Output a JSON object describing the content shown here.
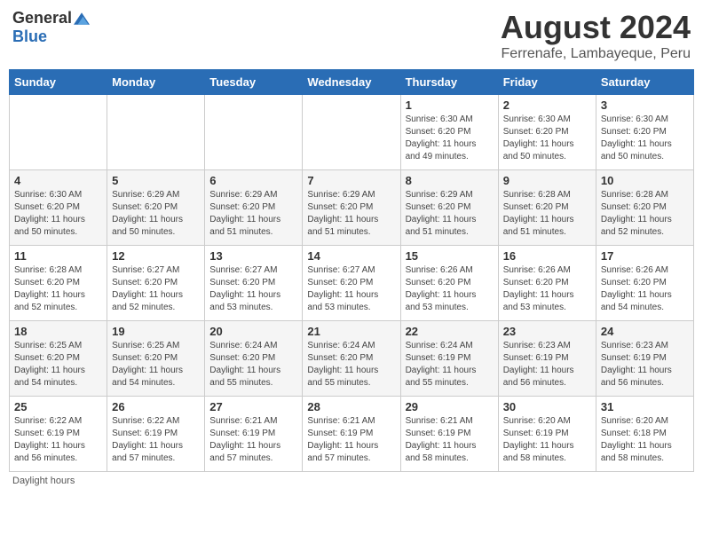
{
  "header": {
    "logo_general": "General",
    "logo_blue": "Blue",
    "month_year": "August 2024",
    "location": "Ferrenafe, Lambayeque, Peru"
  },
  "days_of_week": [
    "Sunday",
    "Monday",
    "Tuesday",
    "Wednesday",
    "Thursday",
    "Friday",
    "Saturday"
  ],
  "weeks": [
    [
      {
        "day": "",
        "info": ""
      },
      {
        "day": "",
        "info": ""
      },
      {
        "day": "",
        "info": ""
      },
      {
        "day": "",
        "info": ""
      },
      {
        "day": "1",
        "info": "Sunrise: 6:30 AM\nSunset: 6:20 PM\nDaylight: 11 hours\nand 49 minutes."
      },
      {
        "day": "2",
        "info": "Sunrise: 6:30 AM\nSunset: 6:20 PM\nDaylight: 11 hours\nand 50 minutes."
      },
      {
        "day": "3",
        "info": "Sunrise: 6:30 AM\nSunset: 6:20 PM\nDaylight: 11 hours\nand 50 minutes."
      }
    ],
    [
      {
        "day": "4",
        "info": "Sunrise: 6:30 AM\nSunset: 6:20 PM\nDaylight: 11 hours\nand 50 minutes."
      },
      {
        "day": "5",
        "info": "Sunrise: 6:29 AM\nSunset: 6:20 PM\nDaylight: 11 hours\nand 50 minutes."
      },
      {
        "day": "6",
        "info": "Sunrise: 6:29 AM\nSunset: 6:20 PM\nDaylight: 11 hours\nand 51 minutes."
      },
      {
        "day": "7",
        "info": "Sunrise: 6:29 AM\nSunset: 6:20 PM\nDaylight: 11 hours\nand 51 minutes."
      },
      {
        "day": "8",
        "info": "Sunrise: 6:29 AM\nSunset: 6:20 PM\nDaylight: 11 hours\nand 51 minutes."
      },
      {
        "day": "9",
        "info": "Sunrise: 6:28 AM\nSunset: 6:20 PM\nDaylight: 11 hours\nand 51 minutes."
      },
      {
        "day": "10",
        "info": "Sunrise: 6:28 AM\nSunset: 6:20 PM\nDaylight: 11 hours\nand 52 minutes."
      }
    ],
    [
      {
        "day": "11",
        "info": "Sunrise: 6:28 AM\nSunset: 6:20 PM\nDaylight: 11 hours\nand 52 minutes."
      },
      {
        "day": "12",
        "info": "Sunrise: 6:27 AM\nSunset: 6:20 PM\nDaylight: 11 hours\nand 52 minutes."
      },
      {
        "day": "13",
        "info": "Sunrise: 6:27 AM\nSunset: 6:20 PM\nDaylight: 11 hours\nand 53 minutes."
      },
      {
        "day": "14",
        "info": "Sunrise: 6:27 AM\nSunset: 6:20 PM\nDaylight: 11 hours\nand 53 minutes."
      },
      {
        "day": "15",
        "info": "Sunrise: 6:26 AM\nSunset: 6:20 PM\nDaylight: 11 hours\nand 53 minutes."
      },
      {
        "day": "16",
        "info": "Sunrise: 6:26 AM\nSunset: 6:20 PM\nDaylight: 11 hours\nand 53 minutes."
      },
      {
        "day": "17",
        "info": "Sunrise: 6:26 AM\nSunset: 6:20 PM\nDaylight: 11 hours\nand 54 minutes."
      }
    ],
    [
      {
        "day": "18",
        "info": "Sunrise: 6:25 AM\nSunset: 6:20 PM\nDaylight: 11 hours\nand 54 minutes."
      },
      {
        "day": "19",
        "info": "Sunrise: 6:25 AM\nSunset: 6:20 PM\nDaylight: 11 hours\nand 54 minutes."
      },
      {
        "day": "20",
        "info": "Sunrise: 6:24 AM\nSunset: 6:20 PM\nDaylight: 11 hours\nand 55 minutes."
      },
      {
        "day": "21",
        "info": "Sunrise: 6:24 AM\nSunset: 6:20 PM\nDaylight: 11 hours\nand 55 minutes."
      },
      {
        "day": "22",
        "info": "Sunrise: 6:24 AM\nSunset: 6:19 PM\nDaylight: 11 hours\nand 55 minutes."
      },
      {
        "day": "23",
        "info": "Sunrise: 6:23 AM\nSunset: 6:19 PM\nDaylight: 11 hours\nand 56 minutes."
      },
      {
        "day": "24",
        "info": "Sunrise: 6:23 AM\nSunset: 6:19 PM\nDaylight: 11 hours\nand 56 minutes."
      }
    ],
    [
      {
        "day": "25",
        "info": "Sunrise: 6:22 AM\nSunset: 6:19 PM\nDaylight: 11 hours\nand 56 minutes."
      },
      {
        "day": "26",
        "info": "Sunrise: 6:22 AM\nSunset: 6:19 PM\nDaylight: 11 hours\nand 57 minutes."
      },
      {
        "day": "27",
        "info": "Sunrise: 6:21 AM\nSunset: 6:19 PM\nDaylight: 11 hours\nand 57 minutes."
      },
      {
        "day": "28",
        "info": "Sunrise: 6:21 AM\nSunset: 6:19 PM\nDaylight: 11 hours\nand 57 minutes."
      },
      {
        "day": "29",
        "info": "Sunrise: 6:21 AM\nSunset: 6:19 PM\nDaylight: 11 hours\nand 58 minutes."
      },
      {
        "day": "30",
        "info": "Sunrise: 6:20 AM\nSunset: 6:19 PM\nDaylight: 11 hours\nand 58 minutes."
      },
      {
        "day": "31",
        "info": "Sunrise: 6:20 AM\nSunset: 6:18 PM\nDaylight: 11 hours\nand 58 minutes."
      }
    ]
  ],
  "footer": {
    "note": "Daylight hours"
  }
}
